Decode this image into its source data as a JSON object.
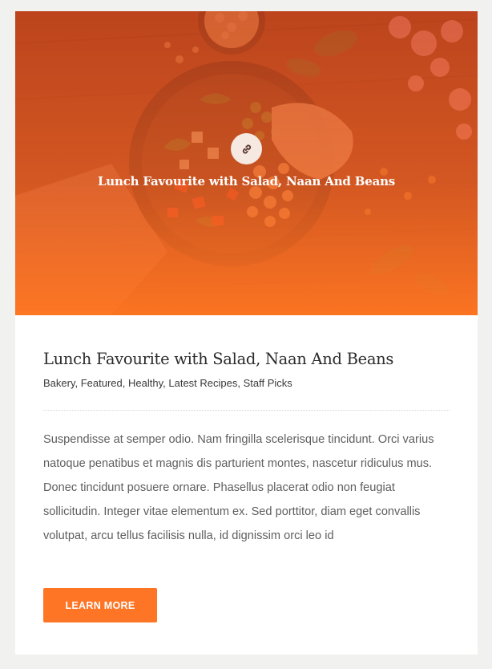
{
  "post": {
    "image_title": "Lunch Favourite with Salad, Naan And Beans",
    "title": "Lunch Favourite with Salad, Naan And Beans",
    "categories": [
      "Bakery",
      "Featured",
      "Healthy",
      "Latest Recipes",
      "Staff Picks"
    ],
    "excerpt": "Suspendisse at semper odio. Nam fringilla scelerisque tincidunt. Orci varius natoque penatibus et magnis dis parturient montes, nascetur ridiculus mus. Donec tincidunt posuere ornare. Phasellus placerat odio non feugiat sollicitudin. Integer vitae elementum ex. Sed porttitor, diam eget convallis volutpat, arcu tellus facilisis nulla, id dignissim orci leo id",
    "button_label": "LEARN MORE"
  },
  "icons": {
    "hero_link": "link-icon"
  },
  "colors": {
    "accent": "#fd7525",
    "overlay_top": "#d6481c",
    "overlay_bottom": "#ff7622",
    "title_text": "#2b2b2b",
    "body_text": "#5e5e5e",
    "page_background": "#f1f1ef"
  }
}
